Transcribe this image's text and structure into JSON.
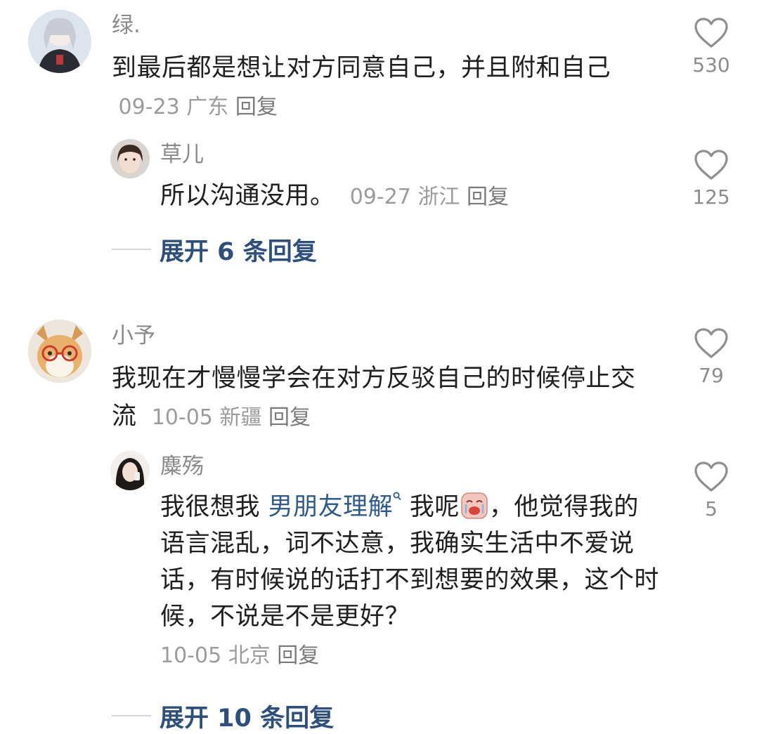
{
  "comments": [
    {
      "username": "绿.",
      "text": "到最后都是想让对方同意自己，并且附和自己",
      "date": "09-23",
      "location": "广东",
      "reply_label": "回复",
      "likes": "530",
      "replies": [
        {
          "username": "草儿",
          "text": "所以沟通没用。",
          "date": "09-27",
          "location": "浙江",
          "reply_label": "回复",
          "likes": "125"
        }
      ],
      "expand_label": "展开 6 条回复"
    },
    {
      "username": "小予",
      "text": "我现在才慢慢学会在对方反驳自己的时候停止交流",
      "date": "10-05",
      "location": "新疆",
      "reply_label": "回复",
      "likes": "79",
      "replies": [
        {
          "username": "麋殇",
          "text_before": "我很想我",
          "link_text": "男朋友理解",
          "text_after_link": "我呢",
          "text_rest": "，他觉得我的语言混乱，词不达意，我确实生活中不爱说话，有时候说的话打不到想要的效果，这个时候，不说是不是更好？",
          "date": "10-05",
          "location": "北京",
          "reply_label": "回复",
          "likes": "5"
        }
      ],
      "expand_label": "展开 10 条回复"
    }
  ],
  "icons": {
    "like": "heart-outline-icon",
    "search": "search-icon",
    "emoji": "crying-face-emoji-icon"
  },
  "colors": {
    "link": "#2f5b8a",
    "expand": "#2d4f7a",
    "meta": "#9b9b9b",
    "username": "#8a8a8a"
  }
}
